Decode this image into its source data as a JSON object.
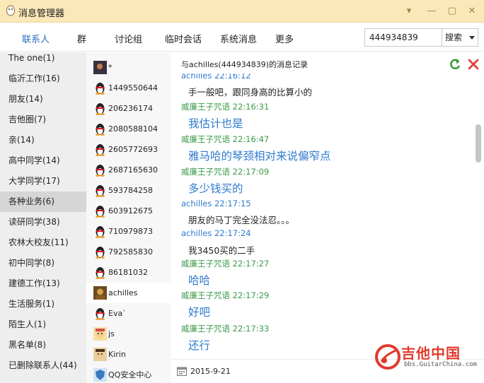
{
  "window": {
    "title": "消息管理器",
    "controls": [
      "▾",
      "—",
      "▢",
      "✕"
    ]
  },
  "tabs": [
    {
      "label": "联系人",
      "active": true
    },
    {
      "label": "群"
    },
    {
      "label": "讨论组"
    },
    {
      "label": "临时会话"
    },
    {
      "label": "系统消息"
    },
    {
      "label": "更多"
    }
  ],
  "search": {
    "value": "444934839",
    "type_label": "搜索"
  },
  "groups": [
    {
      "label": "The one(1)"
    },
    {
      "label": "临沂工作(16)"
    },
    {
      "label": "朋友(14)"
    },
    {
      "label": "吉他圈(7)"
    },
    {
      "label": "亲(14)"
    },
    {
      "label": "高中同学(14)"
    },
    {
      "label": "大学同学(17)"
    },
    {
      "label": "各种业务(6)",
      "selected": true
    },
    {
      "label": "读研同学(38)"
    },
    {
      "label": "农林大校友(11)"
    },
    {
      "label": "初中同学(8)"
    },
    {
      "label": "建德工作(13)"
    },
    {
      "label": "生活服务(1)"
    },
    {
      "label": "陌生人(1)"
    },
    {
      "label": "黑名单(8)"
    },
    {
      "label": "已删除联系人(44)"
    }
  ],
  "contacts": [
    {
      "name": "*",
      "avatar": "photo-avatar"
    },
    {
      "name": "1449550644",
      "avatar": "qq-penguin-icon"
    },
    {
      "name": "206236174",
      "avatar": "qq-penguin-icon"
    },
    {
      "name": "2080588104",
      "avatar": "qq-penguin-icon"
    },
    {
      "name": "2605772693",
      "avatar": "qq-penguin-icon"
    },
    {
      "name": "2687165630",
      "avatar": "qq-penguin-icon"
    },
    {
      "name": "593784258",
      "avatar": "qq-penguin-icon"
    },
    {
      "name": "603912675",
      "avatar": "qq-penguin-icon"
    },
    {
      "name": "710979873",
      "avatar": "qq-penguin-icon"
    },
    {
      "name": "792585830",
      "avatar": "qq-penguin-icon"
    },
    {
      "name": "86181032",
      "avatar": "qq-penguin-icon"
    },
    {
      "name": "achilles",
      "avatar": "photo-avatar",
      "selected": true
    },
    {
      "name": "Eva`",
      "avatar": "qq-penguin-icon"
    },
    {
      "name": "js",
      "avatar": "cartoon-avatar"
    },
    {
      "name": "Kirin",
      "avatar": "cartoon-avatar"
    },
    {
      "name": "QQ安全中心",
      "avatar": "shield-avatar"
    }
  ],
  "message_panel": {
    "header_title": "与achilles(444934839)的消息记录",
    "messages": [
      {
        "kind": "meta",
        "who": "other",
        "text": "achilles 22:16:12"
      },
      {
        "kind": "small",
        "text": "手一般吧，跟同身高的比算小的"
      },
      {
        "kind": "meta",
        "who": "me",
        "text": "威廉王子咒语 22:16:31"
      },
      {
        "kind": "big",
        "text": "我估计也是"
      },
      {
        "kind": "meta",
        "who": "me",
        "text": "威廉王子咒语 22:16:47"
      },
      {
        "kind": "big",
        "text": "雅马哈的琴颈相对来说偏窄点"
      },
      {
        "kind": "meta",
        "who": "me",
        "text": "威廉王子咒语 22:17:09"
      },
      {
        "kind": "big",
        "text": "多少钱买的"
      },
      {
        "kind": "meta",
        "who": "other",
        "text": "achilles 22:17:15"
      },
      {
        "kind": "small",
        "text": "朋友的马丁完全没法忍。。。"
      },
      {
        "kind": "meta",
        "who": "other",
        "text": "achilles 22:17:24"
      },
      {
        "kind": "small",
        "text": "我3450买的二手"
      },
      {
        "kind": "meta",
        "who": "me",
        "text": "威廉王子咒语 22:17:27"
      },
      {
        "kind": "big",
        "text": "哈哈"
      },
      {
        "kind": "meta",
        "who": "me",
        "text": "威廉王子咒语 22:17:29"
      },
      {
        "kind": "big",
        "text": "好吧"
      },
      {
        "kind": "meta",
        "who": "me",
        "text": "威廉王子咒语 22:17:33"
      },
      {
        "kind": "big",
        "text": "还行"
      }
    ],
    "date": "2015-9-21"
  },
  "watermark": {
    "text": "吉他中国",
    "sub": "bbs.GuitarChina.com"
  },
  "colors": {
    "titlebar": "#fbe8b8",
    "active_tab": "#2a6fc2",
    "other_meta": "#2e7bcf",
    "me_meta": "#3a9a48",
    "big_msg": "#2e7bcf",
    "watermark": "#e03a2e"
  }
}
